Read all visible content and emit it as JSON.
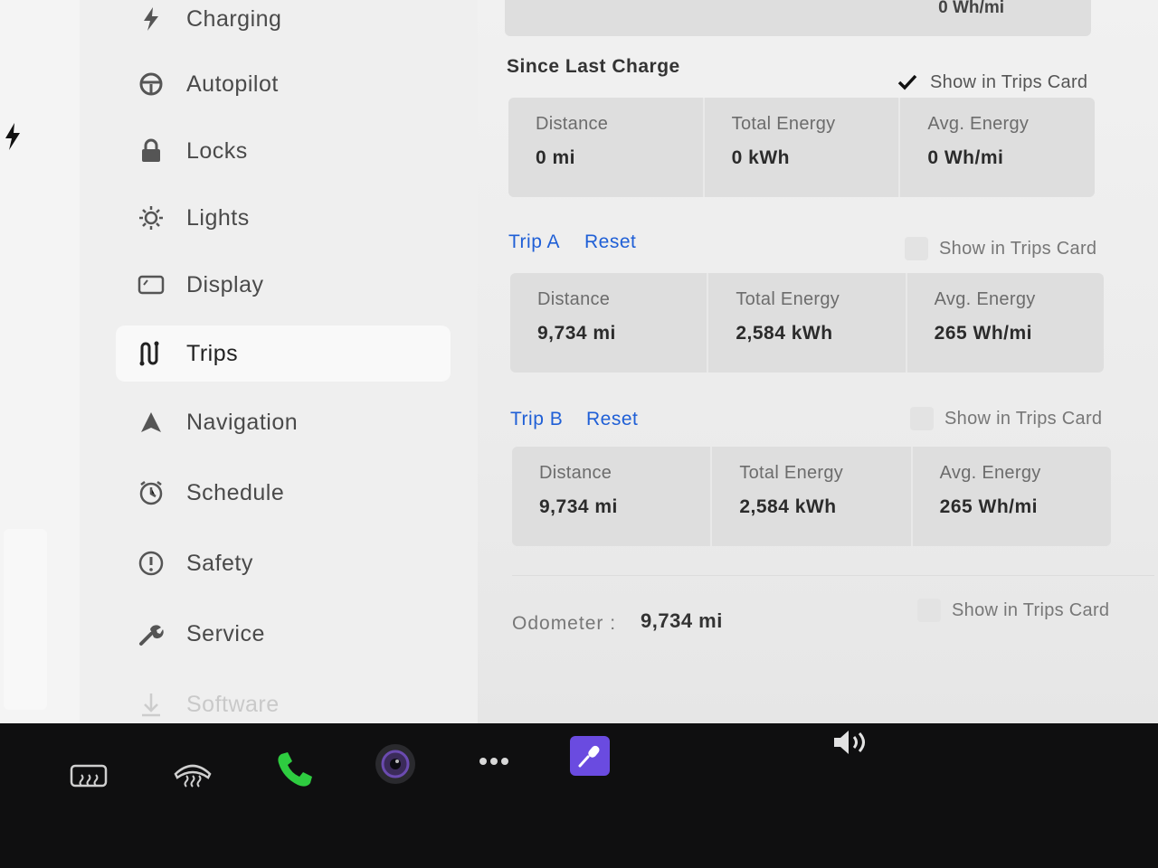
{
  "sidebar": {
    "items": [
      {
        "label": "Charging",
        "icon": "bolt-icon"
      },
      {
        "label": "Autopilot",
        "icon": "steering-wheel-icon"
      },
      {
        "label": "Locks",
        "icon": "lock-icon"
      },
      {
        "label": "Lights",
        "icon": "light-icon"
      },
      {
        "label": "Display",
        "icon": "display-icon"
      },
      {
        "label": "Trips",
        "icon": "trips-icon",
        "active": true
      },
      {
        "label": "Navigation",
        "icon": "navigation-icon"
      },
      {
        "label": "Schedule",
        "icon": "schedule-icon"
      },
      {
        "label": "Safety",
        "icon": "safety-icon"
      },
      {
        "label": "Service",
        "icon": "wrench-icon"
      },
      {
        "label": "Software",
        "icon": "download-icon"
      }
    ]
  },
  "top_card": {
    "value": "0  Wh/mi"
  },
  "since_last_charge": {
    "title": "Since Last Charge",
    "show_in_trips_card": {
      "label": "Show in Trips Card",
      "checked": true
    },
    "distance": {
      "label": "Distance",
      "value": "0  mi"
    },
    "total_energy": {
      "label": "Total Energy",
      "value": "0  kWh"
    },
    "avg_energy": {
      "label": "Avg. Energy",
      "value": "0  Wh/mi"
    }
  },
  "trip_a": {
    "title": "Trip A",
    "reset_label": "Reset",
    "show_in_trips_card": {
      "label": "Show in Trips Card",
      "checked": false
    },
    "distance": {
      "label": "Distance",
      "value": "9,734  mi"
    },
    "total_energy": {
      "label": "Total Energy",
      "value": "2,584  kWh"
    },
    "avg_energy": {
      "label": "Avg. Energy",
      "value": "265  Wh/mi"
    }
  },
  "trip_b": {
    "title": "Trip B",
    "reset_label": "Reset",
    "show_in_trips_card": {
      "label": "Show in Trips Card",
      "checked": false
    },
    "distance": {
      "label": "Distance",
      "value": "9,734  mi"
    },
    "total_energy": {
      "label": "Total Energy",
      "value": "2,584  kWh"
    },
    "avg_energy": {
      "label": "Avg. Energy",
      "value": "265  Wh/mi"
    }
  },
  "odometer": {
    "label": "Odometer  :",
    "value": "9,734  mi",
    "show_in_trips_card": {
      "label": "Show in Trips Card",
      "checked": false
    }
  },
  "taskbar": {
    "icons": [
      "rear-defrost-icon",
      "front-defrost-icon",
      "phone-icon",
      "camera-icon",
      "more-icon",
      "voice-command-icon",
      "volume-icon"
    ]
  },
  "colors": {
    "accent_link": "#1f5fd6",
    "phone_green": "#2ecc40",
    "voice_purple": "#6a4be0",
    "taskbar_bg": "#0f0f10"
  }
}
